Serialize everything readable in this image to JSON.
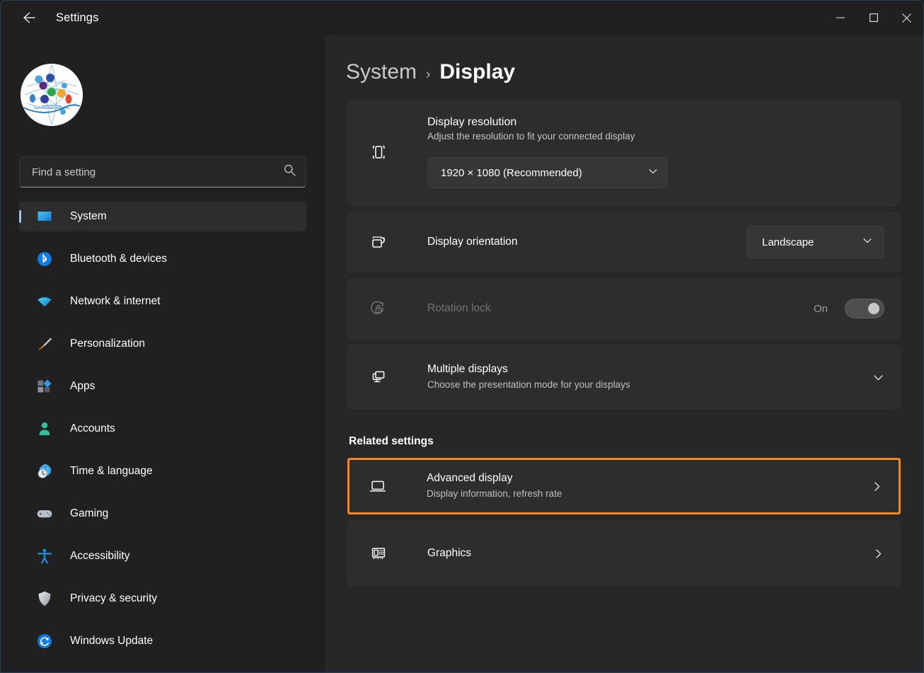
{
  "window": {
    "title": "Settings",
    "back_label": "Back",
    "minimize_label": "Minimize",
    "maximize_label": "Maximize",
    "close_label": "Close"
  },
  "sidebar": {
    "avatar_alt": "account-avatar",
    "search": {
      "placeholder": "Find a setting",
      "value": "",
      "icon": "search-icon"
    },
    "items": [
      {
        "label": "System",
        "icon": "monitor-icon",
        "active": true
      },
      {
        "label": "Bluetooth & devices",
        "icon": "bluetooth-icon",
        "active": false
      },
      {
        "label": "Network & internet",
        "icon": "wifi-icon",
        "active": false
      },
      {
        "label": "Personalization",
        "icon": "paintbrush-icon",
        "active": false
      },
      {
        "label": "Apps",
        "icon": "apps-grid-icon",
        "active": false
      },
      {
        "label": "Accounts",
        "icon": "person-icon",
        "active": false
      },
      {
        "label": "Time & language",
        "icon": "clock-globe-icon",
        "active": false
      },
      {
        "label": "Gaming",
        "icon": "gamepad-icon",
        "active": false
      },
      {
        "label": "Accessibility",
        "icon": "accessibility-person-icon",
        "active": false
      },
      {
        "label": "Privacy & security",
        "icon": "shield-icon",
        "active": false
      },
      {
        "label": "Windows Update",
        "icon": "refresh-circle-icon",
        "active": false
      }
    ]
  },
  "main": {
    "breadcrumb": {
      "parent": "System",
      "separator": "›",
      "current": "Display"
    },
    "display_resolution": {
      "title": "Display resolution",
      "subtitle": "Adjust the resolution to fit your connected display",
      "icon": "resolution-brackets-icon",
      "selected": "1920 × 1080 (Recommended)",
      "chevron": "chevron-down-icon"
    },
    "display_orientation": {
      "title": "Display orientation",
      "icon": "orientation-rotate-icon",
      "selected": "Landscape",
      "chevron": "chevron-down-icon"
    },
    "rotation_lock": {
      "title": "Rotation lock",
      "icon": "rotation-lock-icon",
      "state_label": "On",
      "enabled": false,
      "toggle_on": true
    },
    "multiple_displays": {
      "title": "Multiple displays",
      "subtitle": "Choose the presentation mode for your displays",
      "icon": "multiple-displays-icon",
      "chevron": "chevron-down-icon"
    },
    "related_settings_heading": "Related settings",
    "advanced_display": {
      "title": "Advanced display",
      "subtitle": "Display information, refresh rate",
      "icon": "laptop-display-icon",
      "chevron": "chevron-right-icon",
      "highlighted": true
    },
    "graphics": {
      "title": "Graphics",
      "icon": "graphics-card-icon",
      "chevron": "chevron-right-icon"
    }
  },
  "colors": {
    "accent_highlight": "#f7861f",
    "selection_bar": "#9fc4e8",
    "page_background": "#272727",
    "card_background": "#2d2d2d",
    "sidebar_background": "#202020"
  }
}
